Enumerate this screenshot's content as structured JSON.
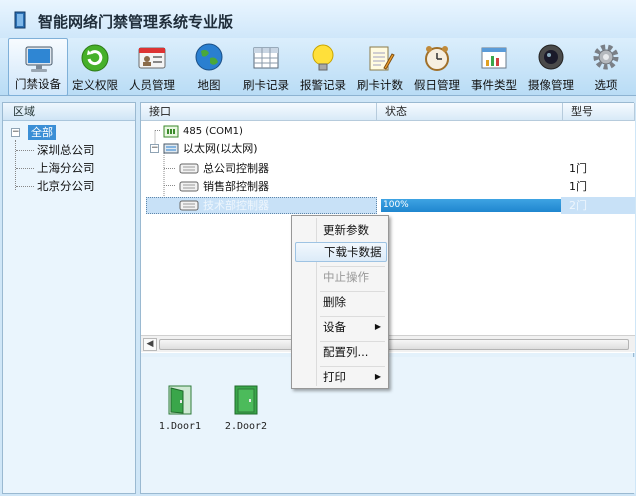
{
  "window": {
    "title": "智能网络门禁管理系统专业版"
  },
  "toolbar": {
    "items": [
      {
        "label": "门禁设备",
        "icon": "monitor-icon",
        "active": true
      },
      {
        "label": "定义权限",
        "icon": "green-refresh-icon"
      },
      {
        "label": "人员管理",
        "icon": "id-card-icon"
      },
      {
        "label": "地图",
        "icon": "globe-icon"
      },
      {
        "label": "刷卡记录",
        "icon": "grid-table-icon"
      },
      {
        "label": "报警记录",
        "icon": "lightbulb-icon"
      },
      {
        "label": "刷卡计数",
        "icon": "notepad-pencil-icon"
      },
      {
        "label": "假日管理",
        "icon": "alarm-clock-icon"
      },
      {
        "label": "事件类型",
        "icon": "window-chart-icon"
      },
      {
        "label": "摄像管理",
        "icon": "camera-lens-icon"
      },
      {
        "label": "选项",
        "icon": "gear-icon"
      }
    ]
  },
  "left": {
    "header": "区域",
    "root": {
      "toggle": "−",
      "label": "全部"
    },
    "children": [
      "深圳总公司",
      "上海分公司",
      "北京分公司"
    ]
  },
  "list": {
    "columns": {
      "port": "接口",
      "status": "状态",
      "model": "型号"
    },
    "rows": [
      {
        "name": "485 (COM1)",
        "status": "",
        "model": ""
      },
      {
        "toggle": "−",
        "name": "以太网(以太网)",
        "status": "",
        "model": ""
      },
      {
        "name": "总公司控制器",
        "status": "",
        "model": "1门"
      },
      {
        "name": "销售部控制器",
        "status": "",
        "model": "1门"
      },
      {
        "name": "技术部控制器",
        "status": "100%",
        "model": "2门",
        "progress": 1.0
      }
    ]
  },
  "context_menu": {
    "items": [
      {
        "label": "更新参数"
      },
      {
        "label": "下载卡数据",
        "highlighted": true
      },
      {
        "label": "中止操作",
        "disabled": true
      },
      {
        "label": "删除"
      },
      {
        "label": "设备",
        "submenu": "▶"
      },
      {
        "label": "配置列..."
      },
      {
        "label": "打印",
        "submenu": "▶"
      }
    ]
  },
  "doors": [
    {
      "label": "1.Door1"
    },
    {
      "label": "2.Door2"
    }
  ],
  "scroll": {
    "left_arrow": "◀"
  },
  "colors": {
    "accent": "#3b8fd6",
    "progress": "#1f86cf",
    "door_green": "#3aa64a"
  }
}
